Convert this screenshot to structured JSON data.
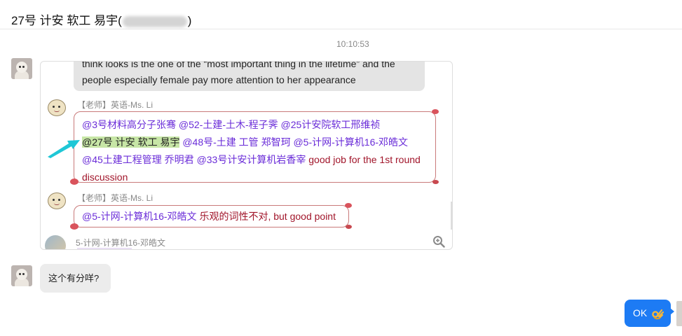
{
  "header": {
    "title_prefix": "27号 计安 软工 易宇(",
    "title_suffix": ")"
  },
  "timestamp": "10:10:53",
  "image_message": {
    "gray_bubble": {
      "line1": "think looks is the one of the “most important thing in the lifetime” and the",
      "line2": "people especially female pay more attention to her appearance"
    },
    "teacher_label": "【老师】英语-Ms. Li",
    "message1": {
      "mentions_line1": "@3号材料高分子张骞 @52-土建-土木-程子霁 @25计安院软工邢维祯",
      "highlight_mention": "@27号 计安 软工 易宇",
      "mentions_line2_rest": " @48号-土建 工管 郑智珂 @5-计网-计算机16-邓皓文",
      "mentions_line3": "@45土建工程管理 乔明君 @33号计安计算机岩香宰",
      "comment": " good job for the 1st round discussion"
    },
    "message2": {
      "mention": "@5-计网-计算机16-邓皓文",
      "comment": " 乐观的词性不对, but good point"
    },
    "bottom_sender": "5-计网-计算机16-邓皓文"
  },
  "text_message": "这个有分咩?",
  "my_message": "OK",
  "colors": {
    "accent_blue": "#1d7bf4",
    "mention_purple": "#6a2cd8",
    "comment_red": "#a1152a",
    "highlight_green": "#c7e6a6",
    "arrow_cyan": "#1fc7d6"
  },
  "icons": [
    "zoom-in-icon",
    "arrow-pointer-icon",
    "ok-hand-emoji"
  ]
}
